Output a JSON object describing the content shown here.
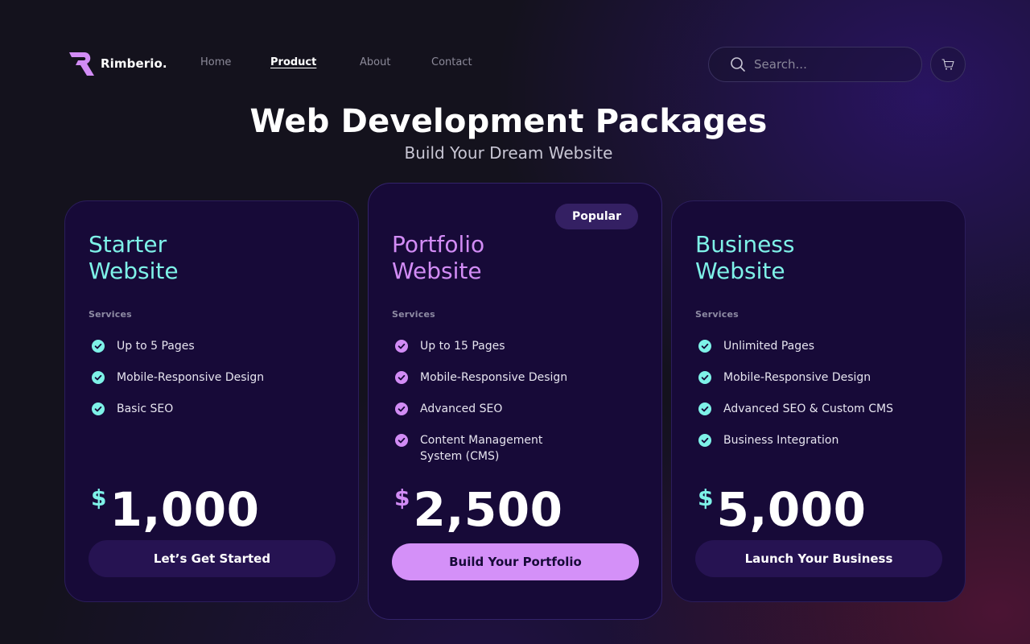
{
  "brand": {
    "name": "Rimberio.",
    "accent": "#d28cf5"
  },
  "nav": {
    "items": [
      {
        "label": "Home",
        "active": false
      },
      {
        "label": "Product",
        "active": true
      },
      {
        "label": "About",
        "active": false
      },
      {
        "label": "Contact",
        "active": false
      }
    ]
  },
  "search": {
    "placeholder": "Search...",
    "icon": "search-icon"
  },
  "cart": {
    "icon": "cart-icon"
  },
  "hero": {
    "title": "Web Development Packages",
    "subtitle": "Build Your Dream Website"
  },
  "colors": {
    "teal": "#7ef2e8",
    "violet": "#d28cf5",
    "card_bg": "#170a38"
  },
  "plans": [
    {
      "title_line1": "Starter",
      "title_line2": "Website",
      "services_label": "Services",
      "features": [
        "Up to 5 Pages",
        "Mobile-Responsive Design",
        "Basic SEO"
      ],
      "currency": "$",
      "price": "1,000",
      "cta": "Let’s Get Started"
    },
    {
      "badge": "Popular",
      "title_line1": "Portfolio",
      "title_line2": "Website",
      "services_label": "Services",
      "features": [
        "Up to 15 Pages",
        "Mobile-Responsive Design",
        "Advanced SEO",
        "Content Management System (CMS)"
      ],
      "currency": "$",
      "price": "2,500",
      "cta": "Build Your Portfolio"
    },
    {
      "title_line1": "Business",
      "title_line2": "Website",
      "services_label": "Services",
      "features": [
        "Unlimited Pages",
        "Mobile-Responsive Design",
        "Advanced SEO & Custom CMS",
        "Business Integration"
      ],
      "currency": "$",
      "price": "5,000",
      "cta": "Launch Your Business"
    }
  ]
}
